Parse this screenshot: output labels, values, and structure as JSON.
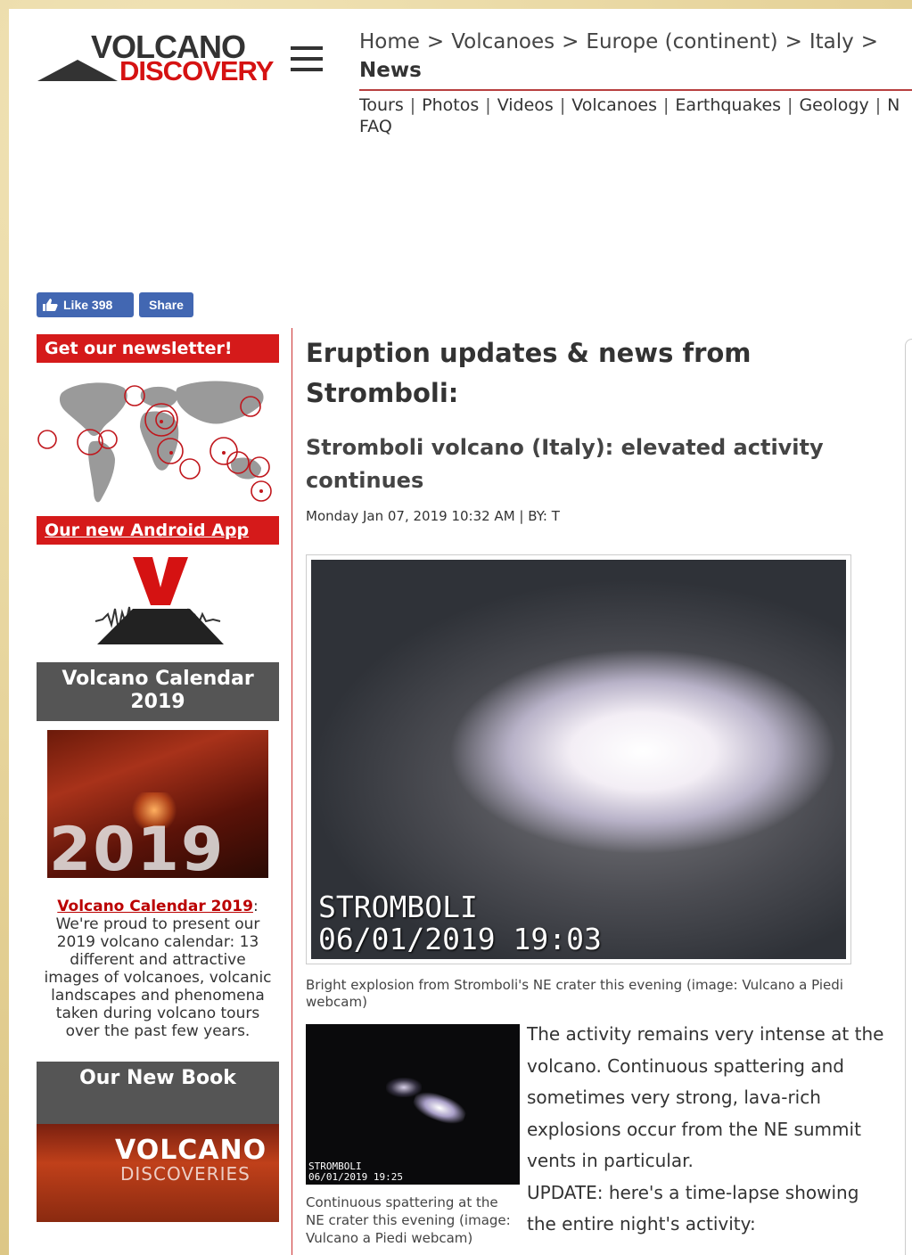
{
  "header": {
    "logo_line1": "VOLCANO",
    "logo_line2": "DISCOVERY",
    "breadcrumb": [
      "Home",
      "Volcanoes",
      "Europe (continent)",
      "Italy"
    ],
    "breadcrumb_separator": ">",
    "current_section": "News",
    "nav": [
      "Tours",
      "Photos",
      "Videos",
      "Volcanoes",
      "Earthquakes",
      "Geology",
      "N"
    ],
    "nav_second_line": "FAQ"
  },
  "social": {
    "like_label": "Like 398",
    "share_label": "Share"
  },
  "sidebar": {
    "newsletter_label": "Get our newsletter!",
    "android_label": "Our new Android App",
    "calendar_banner": "Volcano Calendar 2019",
    "calendar_image_year": "2019",
    "calendar_link": "Volcano Calendar 2019",
    "calendar_text": ": We're proud to present our 2019 volcano calendar: 13 different and attractive images of volcanoes, volcanic landscapes and phenomena taken during volcano tours over the past few years.",
    "book_banner": "Our New Book",
    "book_title_line1": "VOLCANO",
    "book_title_line2": "DISCOVERIES"
  },
  "article": {
    "heading": "Eruption updates & news from Stromboli:",
    "title": "Stromboli volcano (Italy): elevated activity continues",
    "byline": "Monday Jan 07, 2019 10:32 AM | BY: T",
    "photo_stamp_line1": "STROMBOLI",
    "photo_stamp_line2": "06/01/2019 19:03",
    "photo_caption": "Bright explosion from Stromboli's NE crater this evening (image: Vulcano a Piedi webcam)",
    "thumb_stamp_line1": "STROMBOLI",
    "thumb_stamp_line2": "06/01/2019 19:25",
    "thumb_caption": "Continuous spattering at the NE crater this evening (image: Vulcano a Piedi webcam)",
    "paragraph1": "The activity remains very intense at the volcano. Continuous spattering and sometimes very strong, lava-rich explosions occur from the NE summit vents in particular.",
    "paragraph2": "UPDATE: here's a time-lapse showing the entire night's activity:"
  },
  "colors": {
    "accent_red": "#d51a1a",
    "facebook_blue": "#4267b2",
    "banner_gray": "#555555"
  }
}
